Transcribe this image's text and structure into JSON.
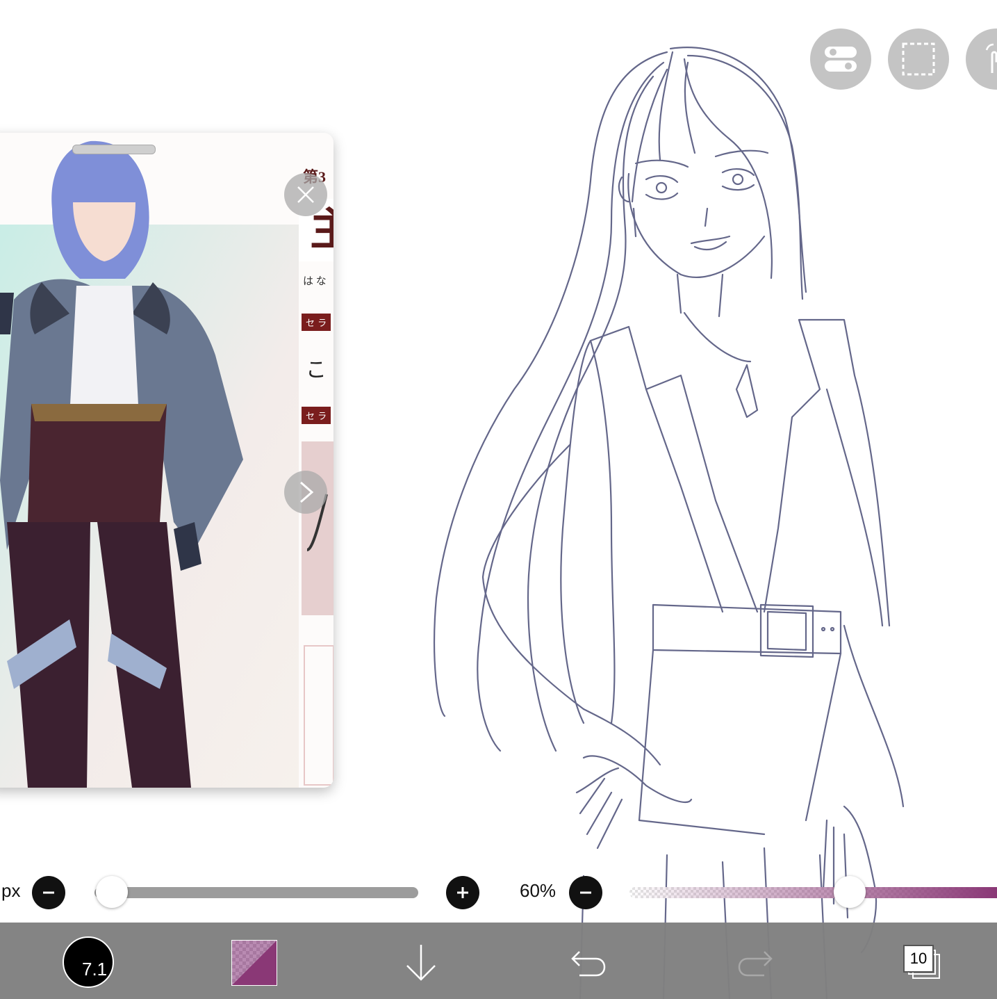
{
  "top_tools": {
    "toggle_icon": "toggle-switch-icon",
    "selection_icon": "dashed-selection-icon",
    "gesture_icon": "touch-hand-icon"
  },
  "reference_window": {
    "heading_chapter": "第3",
    "heading_big": "主",
    "reading": "は な",
    "tag1": "セ ラ",
    "line1": "こ",
    "tag2": "セ ラ",
    "close_icon": "close-icon",
    "next_icon": "chevron-right-icon"
  },
  "brush_controls": {
    "size_unit": "px",
    "opacity_label": "60%",
    "opacity_value": 0.6,
    "size_value": 0.0,
    "accent_color": "#8a3876"
  },
  "toolbar": {
    "brush_size": "7.1",
    "layer_count": "10",
    "color": "#8a3876"
  }
}
